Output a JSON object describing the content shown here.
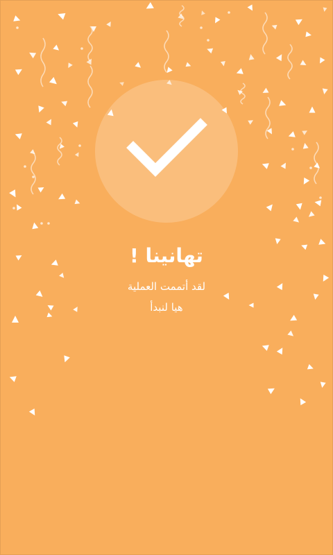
{
  "screen": {
    "background_color": "#f9ae5c",
    "confetti_color": "#ffffff",
    "title": "تهانينا !",
    "message": "لقد أتممت العملية",
    "cta": "هيا لنبدأ"
  },
  "icons": {
    "success": "checkmark-icon"
  }
}
